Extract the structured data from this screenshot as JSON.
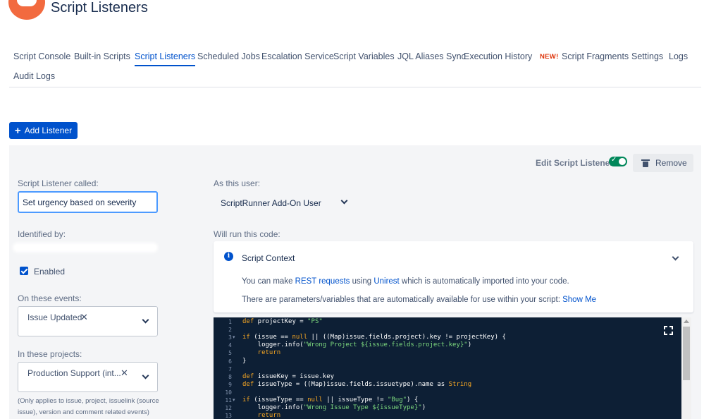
{
  "header": {
    "title": "Script Listeners"
  },
  "tabs": [
    {
      "label": "Script Console"
    },
    {
      "label": "Built-in Scripts"
    },
    {
      "label": "Script Listeners",
      "active": true
    },
    {
      "label": "Scheduled Jobs"
    },
    {
      "label": "Escalation Service"
    },
    {
      "label": "Script Variables"
    },
    {
      "label": "JQL Aliases Sync"
    },
    {
      "label": "Execution History"
    },
    {
      "label": "Script Fragments",
      "badge": "NEW!"
    },
    {
      "label": "Settings"
    },
    {
      "label": "Logs"
    },
    {
      "label": "Audit Logs"
    }
  ],
  "toolbar": {
    "add_label": "Add Listener"
  },
  "editor": {
    "edit_label": "Edit Script Listener",
    "toggle_on": true,
    "remove_label": "Remove",
    "name_label": "Script Listener called:",
    "name_value": "Set urgency based on severity",
    "identified_label": "Identified by:",
    "enabled_label": "Enabled",
    "enabled": true,
    "events_label": "On these events:",
    "events": [
      "Issue Updated"
    ],
    "projects_label": "In these projects:",
    "projects": [
      "Production Support (int..."
    ],
    "projects_note": "(Only applies to issue, project, issuelink (source issue), version and comment related events)",
    "user_label": "As this user:",
    "user_value": "ScriptRunner Add-On User",
    "code_label": "Will run this code:"
  },
  "context": {
    "title": "Script Context",
    "line1_pre": "You can make ",
    "line1_link1": "REST requests",
    "line1_mid": " using ",
    "line1_link2": "Unirest",
    "line1_post": " which is automatically imported into your code.",
    "line2_pre": "There are parameters/variables that are automatically available for use within your script: ",
    "line2_link": "Show Me"
  },
  "code": {
    "lines": [
      [
        [
          "kw",
          "def"
        ],
        [
          "t",
          " projectKey = "
        ],
        [
          "str",
          "\"PS\""
        ]
      ],
      [],
      [
        [
          "kw",
          "if"
        ],
        [
          "t",
          " (issue == "
        ],
        [
          "kw",
          "null"
        ],
        [
          "t",
          " || ((Map)issue.fields.project).key != projectKey) {"
        ]
      ],
      [
        [
          "t",
          "    logger.info("
        ],
        [
          "str",
          "\"Wrong Project ${issue.fields.project.key}\""
        ],
        [
          "t",
          ")"
        ]
      ],
      [
        [
          "kw",
          "    return"
        ]
      ],
      [
        [
          "t",
          "}"
        ]
      ],
      [],
      [
        [
          "kw",
          "def"
        ],
        [
          "t",
          " issueKey = issue.key"
        ]
      ],
      [
        [
          "kw",
          "def"
        ],
        [
          "t",
          " issueType = ((Map)issue.fields.issuetype).name as "
        ],
        [
          "kw",
          "String"
        ]
      ],
      [],
      [
        [
          "kw",
          "if"
        ],
        [
          "t",
          " (issueType == "
        ],
        [
          "kw",
          "null"
        ],
        [
          "t",
          " || issueType != "
        ],
        [
          "str",
          "\"Bug\""
        ],
        [
          "t",
          ") {"
        ]
      ],
      [
        [
          "t",
          "    logger.info("
        ],
        [
          "str",
          "\"Wrong Issue Type ${issueType}\""
        ],
        [
          "t",
          ")"
        ]
      ],
      [
        [
          "kw",
          "    return"
        ]
      ]
    ],
    "numbers": [
      "1",
      "2",
      "3",
      "4",
      "5",
      "6",
      "7",
      "8",
      "9",
      "10",
      "11",
      "12",
      "13"
    ],
    "fold_lines": [
      3,
      11
    ]
  },
  "colors": {
    "accent": "#0052cc",
    "toggle_on": "#00875a",
    "badge_new": "#de350b",
    "editor_bg": "#0d1f35",
    "keyword": "#f5a623",
    "string": "#7fdc7f"
  }
}
